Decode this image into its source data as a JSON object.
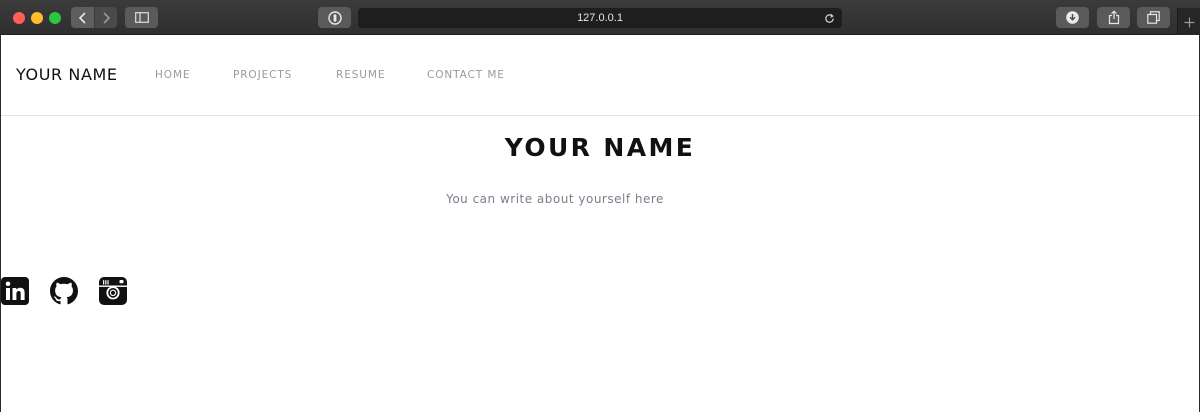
{
  "browser": {
    "url": "127.0.0.1",
    "icons": [
      "back-icon",
      "forward-icon",
      "sidebar-icon",
      "password-manager-icon",
      "reload-icon",
      "download-icon",
      "share-icon",
      "tabs-icon",
      "plus-icon"
    ]
  },
  "site": {
    "brand": "YOUR NAME",
    "nav": [
      "HOME",
      "PROJECTS",
      "RESUME",
      "CONTACT ME"
    ],
    "hero_title": "YOUR NAME",
    "hero_subtitle": "You can write about yourself here",
    "social_icons": [
      "linkedin-icon",
      "github-icon",
      "instagram-icon"
    ]
  },
  "colors": {
    "nav_text": "#9a9a9a",
    "subtitle": "#7a818c",
    "chrome": "#2f2f2f"
  }
}
